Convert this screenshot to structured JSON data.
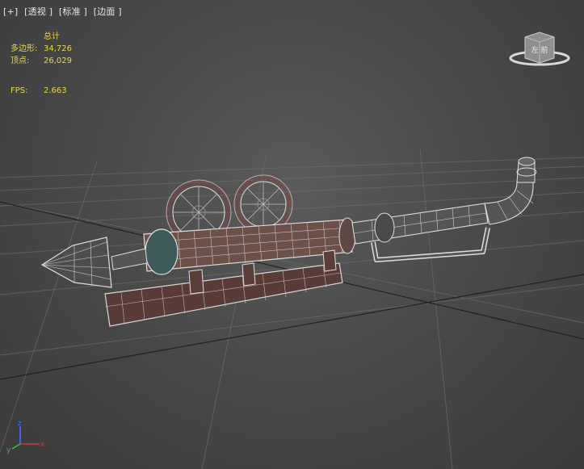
{
  "viewport": {
    "labels": [
      "[+]",
      "[透视 ]",
      "[标准 ]",
      "[边面 ]"
    ]
  },
  "stats": {
    "header": "总计",
    "polygons_label": "多边形:",
    "polygons_value": "34,726",
    "vertices_label": "顶点:",
    "vertices_value": "26,029",
    "fps_label": "FPS:",
    "fps_value": "2.663"
  },
  "viewcube": {
    "face_label": "左 前"
  },
  "axis": {
    "x": "x",
    "y": "y",
    "z": "z"
  },
  "colors": {
    "background": "#4a4a4a",
    "stats_text": "#e8d84a",
    "wire": "#d8d8d8",
    "rust": "#7a3a2e",
    "axis_x": "#d23c3c",
    "axis_y": "#3cc43c",
    "axis_z": "#4a6cff"
  }
}
